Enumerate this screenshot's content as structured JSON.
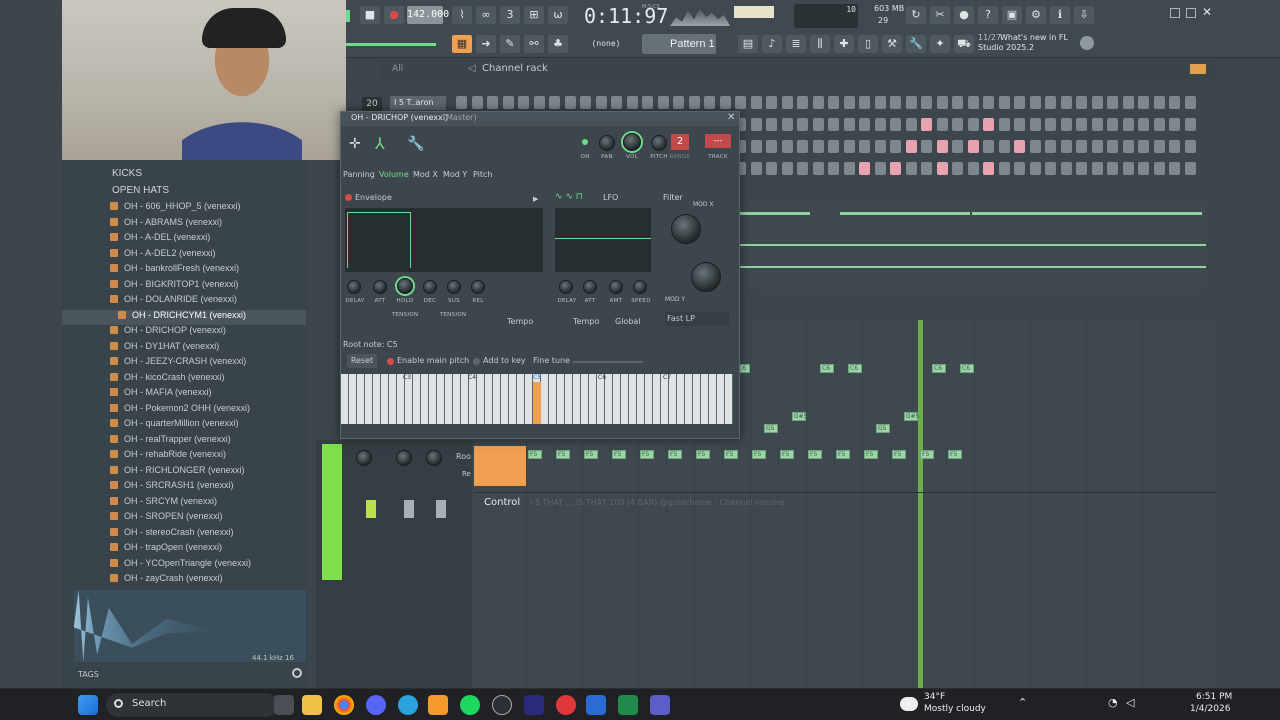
{
  "top": {
    "tempo": "142.000",
    "time": "0:11:97",
    "time_label": "M:S:CS",
    "cpu": "10",
    "mem": "603 MB",
    "mem_sub": "29",
    "pattern_mode": "(none)",
    "pattern": "Pattern 1",
    "news_count": "11/27",
    "news_text": "What's new in FL Studio 2025.2"
  },
  "channel_rack": {
    "filter": "All",
    "title": "Channel rack",
    "swing": "20",
    "channel_name": "I 5 T..aron"
  },
  "browser": {
    "folders": [
      "KICKS",
      "OPEN HATS"
    ],
    "items": [
      "OH - 606_HHOP_5 (venexxi)",
      "OH - ABRAMS (venexxi)",
      "OH - A-DEL (venexxi)",
      "OH - A-DEL2 (venexxi)",
      "OH - bankrollFresh (venexxi)",
      "OH - BIGKRITOP1 (venexxi)",
      "OH - DOLANRIDE (venexxi)",
      "OH - DRICHCYM1 (venexxi)",
      "OH - DRICHOP (venexxi)",
      "OH - DY1HAT (venexxi)",
      "OH - JEEZY-CRASH (venexxi)",
      "OH - kicoCrash (venexxi)",
      "OH - MAFIA (venexxi)",
      "OH - Pokemon2 OHH (venexxi)",
      "OH - quarterMillion (venexxi)",
      "OH - realTrapper (venexxi)",
      "OH - rehabRide (venexxi)",
      "OH - RICHLONGER (venexxi)",
      "OH - SRCRASH1 (venexxi)",
      "OH - SRCYM (venexxi)",
      "OH - SROPEN (venexxi)",
      "OH - stereoCrash (venexxi)",
      "OH - trapOpen (venexxi)",
      "OH - YCOpenTriangle (venexxi)",
      "OH - zayCrash (venexxi)"
    ],
    "selected_index": 7,
    "sample_info": "44.1 kHz 16",
    "tags": "TAGS"
  },
  "plugin": {
    "title": "OH - DRICHOP (venexxi)",
    "title_sub": "(Master)",
    "tabs": [
      "Panning",
      "Volume",
      "Mod X",
      "Mod Y",
      "Pitch"
    ],
    "active_tab": "Volume",
    "top_knobs": [
      "ON",
      "PAN",
      "VOL",
      "PITCH",
      "RANGE",
      "TRACK"
    ],
    "track_value": "2",
    "envelope_label": "Envelope",
    "lfo_label": "LFO",
    "filter_label": "Filter",
    "mod_x": "MOD X",
    "mod_y": "MOD Y",
    "env_knobs": [
      "DELAY",
      "ATT",
      "HOLD",
      "DEC",
      "SUS",
      "REL"
    ],
    "tension": "TENSION",
    "tempo": "Tempo",
    "lfo_knobs": [
      "DELAY",
      "ATT",
      "AMT",
      "SPEED"
    ],
    "global": "Global",
    "filter_type": "Fast LP",
    "root_note": "Root note: C5",
    "reset": "Reset",
    "enable_main_pitch": "Enable main pitch",
    "add_to_key": "Add to key",
    "fine_tune": "Fine tune",
    "octaves": [
      "C3",
      "C4",
      "C5",
      "C6",
      "C7"
    ]
  },
  "mixer": {
    "root_label": "Roo",
    "re_label": "Re"
  },
  "piano_roll": {
    "control": "Control",
    "control_info": "I 5 THAT ... IS THAT 100 (4 BAR) @goldchaine - Channel volume",
    "notes": [
      "F5",
      "F5",
      "F5",
      "F5",
      "F5",
      "F5",
      "F5",
      "F5",
      "F5",
      "F5",
      "F5",
      "F5",
      "F5",
      "F5",
      "F5",
      "F5",
      "G5",
      "G5",
      "G#5",
      "G#5",
      "C6",
      "C6",
      "C6",
      "C6",
      "C6"
    ]
  },
  "taskbar": {
    "search": "Search",
    "weather_temp": "34°F",
    "weather_text": "Mostly cloudy",
    "time": "6:51 PM",
    "date": "1/4/2026"
  },
  "colors": {
    "accent_green": "#6fdc8c",
    "accent_orange": "#f0a050",
    "record_red": "#d94a4a"
  }
}
